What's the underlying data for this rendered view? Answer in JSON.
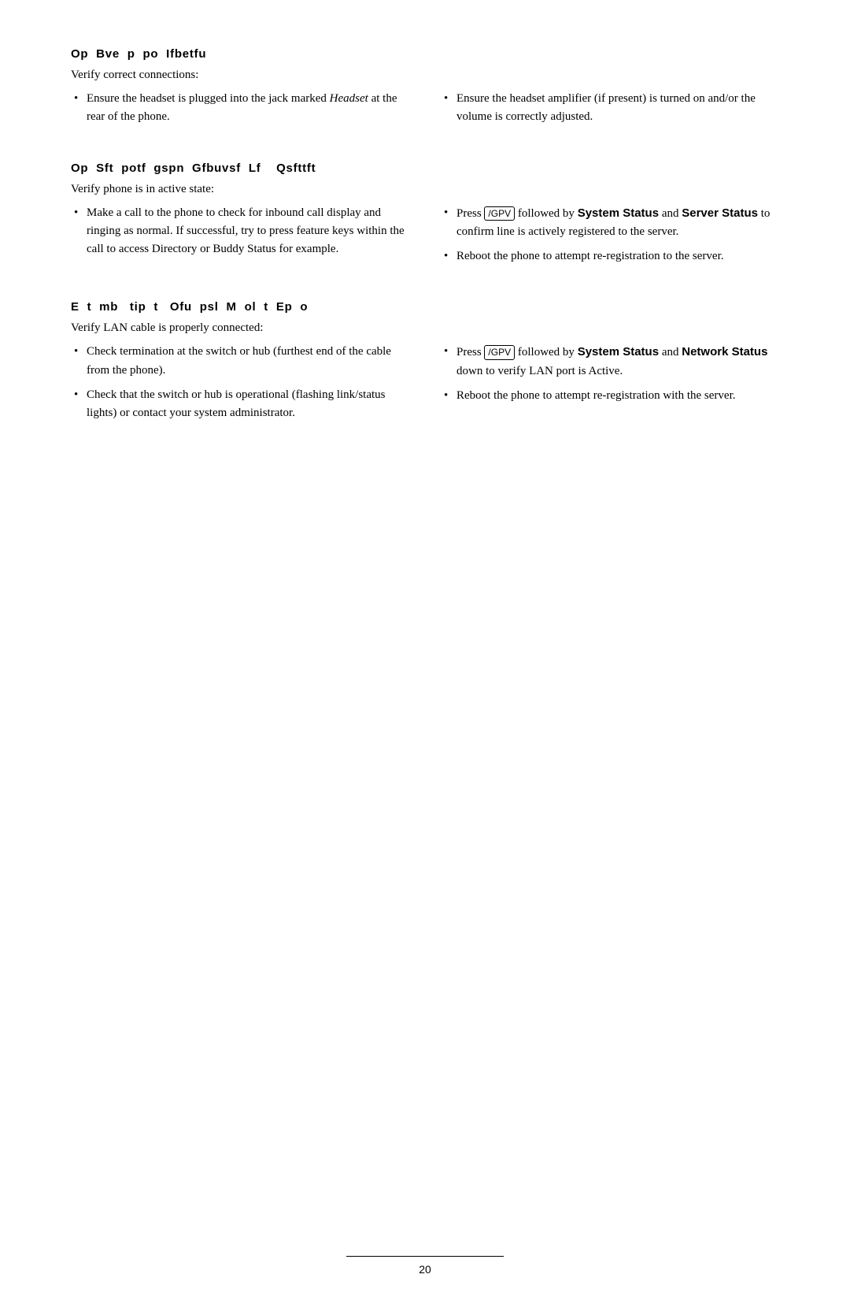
{
  "page": {
    "number": "20"
  },
  "sections": [
    {
      "id": "headset-connections",
      "heading": "Op  Bve  p  po  Ifbetfu",
      "intro": "Verify correct connections:",
      "columns": [
        {
          "items": [
            "Ensure the headset is plugged into the jack marked <em>Headset</em> at the rear of the phone."
          ]
        },
        {
          "items": [
            "Ensure the headset amplifier (if present) is turned on and/or the volume is correctly adjusted."
          ]
        }
      ]
    },
    {
      "id": "phone-active",
      "heading": "Op  Sft  potf  gspn  Gfbuvsf  Lf    Qsfttft",
      "intro": "Verify phone is in active state:",
      "columns": [
        {
          "items": [
            "Make a call to the phone to check for inbound call display and ringing as normal. If successful, try to press feature keys within the call to access Directory or Buddy Status for example."
          ]
        },
        {
          "items": [
            "Press [/GPV] followed by <strong>System Status</strong> and <strong>Server Status</strong> to confirm line is actively registered to the server.",
            "Reboot the phone to attempt re-registration to the server."
          ]
        }
      ]
    },
    {
      "id": "lan-cable",
      "heading": "E  t  mb   tip  t   Ofu  psl  M  ol  t  Ep  o",
      "intro": "Verify LAN cable is properly connected:",
      "columns": [
        {
          "items": [
            "Check termination at the switch or hub (furthest end of the cable from the phone).",
            "Check that the switch or hub is operational (flashing link/status lights) or contact your system administrator."
          ]
        },
        {
          "items": [
            "Press [/GPV] followed by <strong>System Status</strong> and <strong>Network Status</strong> down to verify LAN port is Active.",
            "Reboot the phone to attempt re-registration with the server."
          ]
        }
      ]
    }
  ],
  "labels": {
    "key_gpv": "/GPV",
    "system_status": "System Status",
    "server_status": "Server Status",
    "network_status": "Network Status"
  }
}
